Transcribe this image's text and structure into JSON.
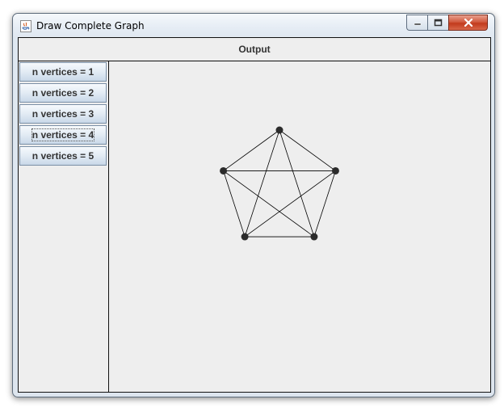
{
  "window": {
    "title": "Draw Complete Graph",
    "controls": {
      "minimize": "minimize-icon",
      "maximize": "maximize-icon",
      "close": "close-icon"
    },
    "close_color": "#c7432a"
  },
  "output": {
    "header": "Output"
  },
  "sidebar": {
    "buttons": [
      {
        "label": "n vertices = 1"
      },
      {
        "label": "n vertices = 2"
      },
      {
        "label": "n vertices = 3"
      },
      {
        "label": "n vertices = 4"
      },
      {
        "label": "n vertices = 5"
      }
    ],
    "focused_index": 3
  },
  "graph": {
    "type": "complete-graph",
    "vertex_count": 5,
    "vertex_color": "#2b2b2b",
    "edge_color": "#000000"
  }
}
